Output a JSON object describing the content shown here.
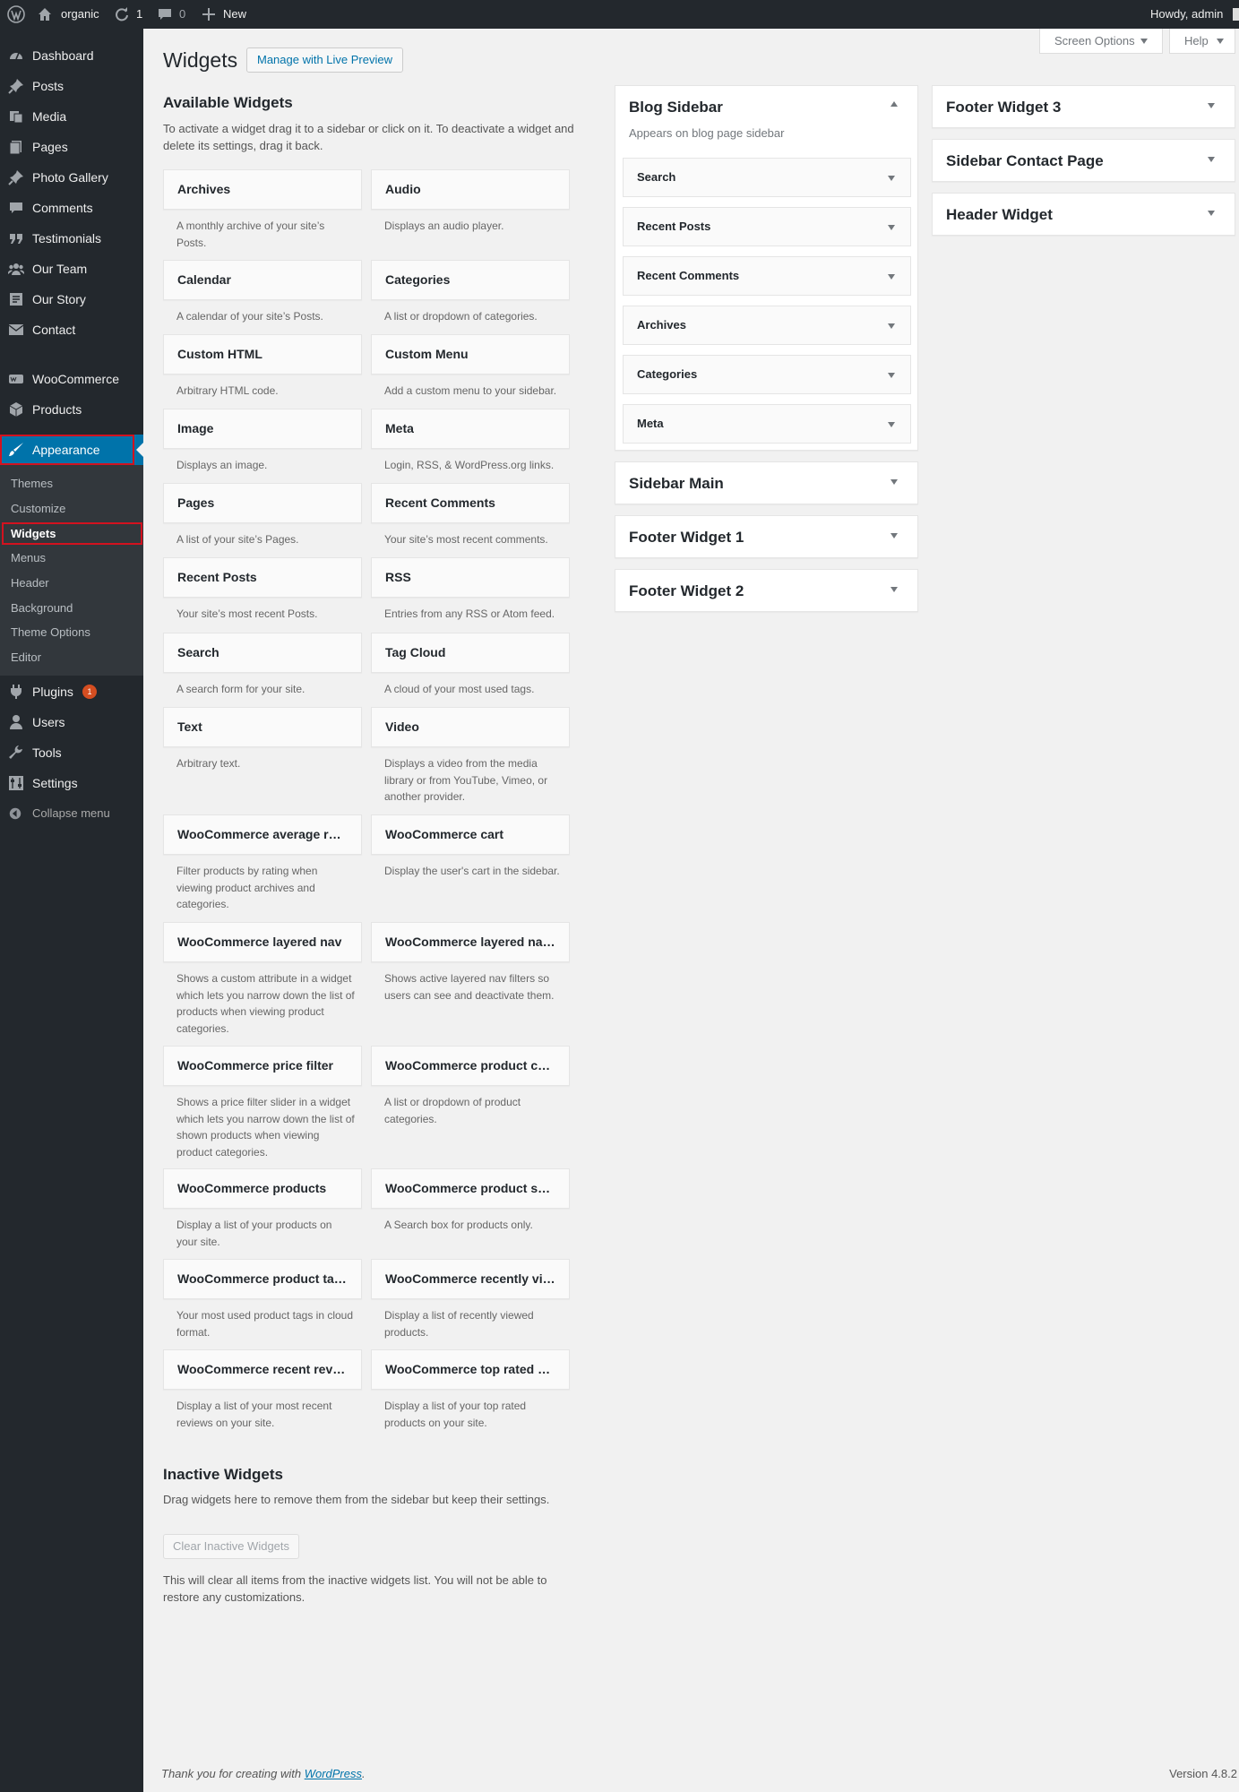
{
  "admin_bar": {
    "site_name": "organic",
    "updates_count": "1",
    "comments_count": "0",
    "new_label": "New",
    "howdy": "Howdy, admin"
  },
  "sidebar": {
    "items": [
      {
        "label": "Dashboard",
        "icon": "dashboard-icon"
      },
      {
        "label": "Posts",
        "icon": "pin-icon"
      },
      {
        "label": "Media",
        "icon": "media-icon"
      },
      {
        "label": "Pages",
        "icon": "pages-icon"
      },
      {
        "label": "Photo Gallery",
        "icon": "pin-icon"
      },
      {
        "label": "Comments",
        "icon": "comment-icon"
      },
      {
        "label": "Testimonials",
        "icon": "quote-icon"
      },
      {
        "label": "Our Team",
        "icon": "team-icon"
      },
      {
        "label": "Our Story",
        "icon": "book-icon"
      },
      {
        "label": "Contact",
        "icon": "email-icon"
      },
      {
        "label": "WooCommerce",
        "icon": "woo-icon"
      },
      {
        "label": "Products",
        "icon": "products-icon"
      },
      {
        "label": "Appearance",
        "icon": "brush-icon"
      },
      {
        "label": "Plugins",
        "icon": "plugin-icon",
        "badge": "1"
      },
      {
        "label": "Users",
        "icon": "user-icon"
      },
      {
        "label": "Tools",
        "icon": "wrench-icon"
      },
      {
        "label": "Settings",
        "icon": "settings-icon"
      }
    ],
    "submenu": [
      "Themes",
      "Customize",
      "Widgets",
      "Menus",
      "Header",
      "Background",
      "Theme Options",
      "Editor"
    ],
    "collapse_label": "Collapse menu"
  },
  "screen_options_label": "Screen Options",
  "help_label": "Help",
  "page_title": "Widgets",
  "live_preview_label": "Manage with Live Preview",
  "available": {
    "title": "Available Widgets",
    "description": "To activate a widget drag it to a sidebar or click on it. To deactivate a widget and delete its settings, drag it back.",
    "widgets": [
      {
        "name": "Archives",
        "desc": "A monthly archive of your site’s Posts."
      },
      {
        "name": "Audio",
        "desc": "Displays an audio player."
      },
      {
        "name": "Calendar",
        "desc": "A calendar of your site’s Posts."
      },
      {
        "name": "Categories",
        "desc": "A list or dropdown of categories."
      },
      {
        "name": "Custom HTML",
        "desc": "Arbitrary HTML code."
      },
      {
        "name": "Custom Menu",
        "desc": "Add a custom menu to your sidebar."
      },
      {
        "name": "Image",
        "desc": "Displays an image."
      },
      {
        "name": "Meta",
        "desc": "Login, RSS, & WordPress.org links."
      },
      {
        "name": "Pages",
        "desc": "A list of your site’s Pages."
      },
      {
        "name": "Recent Comments",
        "desc": "Your site’s most recent comments."
      },
      {
        "name": "Recent Posts",
        "desc": "Your site’s most recent Posts."
      },
      {
        "name": "RSS",
        "desc": "Entries from any RSS or Atom feed."
      },
      {
        "name": "Search",
        "desc": "A search form for your site."
      },
      {
        "name": "Tag Cloud",
        "desc": "A cloud of your most used tags."
      },
      {
        "name": "Text",
        "desc": "Arbitrary text."
      },
      {
        "name": "Video",
        "desc": "Displays a video from the media library or from YouTube, Vimeo, or another provider."
      },
      {
        "name": "WooCommerce average rating filter",
        "desc": "Filter products by rating when viewing product archives and categories."
      },
      {
        "name": "WooCommerce cart",
        "desc": "Display the user's cart in the sidebar."
      },
      {
        "name": "WooCommerce layered nav",
        "desc": "Shows a custom attribute in a widget which lets you narrow down the list of products when viewing product categories."
      },
      {
        "name": "WooCommerce layered nav filters",
        "desc": "Shows active layered nav filters so users can see and deactivate them."
      },
      {
        "name": "WooCommerce price filter",
        "desc": "Shows a price filter slider in a widget which lets you narrow down the list of shown products when viewing product categories."
      },
      {
        "name": "WooCommerce product categories",
        "desc": "A list or dropdown of product categories."
      },
      {
        "name": "WooCommerce products",
        "desc": "Display a list of your products on your site."
      },
      {
        "name": "WooCommerce product search",
        "desc": "A Search box for products only."
      },
      {
        "name": "WooCommerce product tags",
        "desc": "Your most used product tags in cloud format."
      },
      {
        "name": "WooCommerce recently viewed",
        "desc": "Display a list of recently viewed products."
      },
      {
        "name": "WooCommerce recent reviews",
        "desc": "Display a list of your most recent reviews on your site."
      },
      {
        "name": "WooCommerce top rated products",
        "desc": "Display a list of your top rated products on your site."
      }
    ]
  },
  "blog_sidebar": {
    "title": "Blog Sidebar",
    "description": "Appears on blog page sidebar",
    "widgets": [
      "Search",
      "Recent Posts",
      "Recent Comments",
      "Archives",
      "Categories",
      "Meta"
    ]
  },
  "collapsed_sidebars_col2": [
    "Sidebar Main",
    "Footer Widget 1",
    "Footer Widget 2"
  ],
  "collapsed_sidebars_col3": [
    "Footer Widget 3",
    "Sidebar Contact Page",
    "Header Widget"
  ],
  "inactive": {
    "title": "Inactive Widgets",
    "description": "Drag widgets here to remove them from the sidebar but keep their settings.",
    "clear_label": "Clear Inactive Widgets",
    "note": "This will clear all items from the inactive widgets list. You will not be able to restore any customizations."
  },
  "footer": {
    "thanks_prefix": "Thank you for creating with ",
    "thanks_link": "WordPress",
    "thanks_suffix": ".",
    "version": "Version 4.8.2"
  },
  "colors": {
    "admin_dark": "#23282d",
    "submenu_dark": "#32373c",
    "accent_blue": "#0073aa",
    "highlight_red": "#d3121f",
    "badge_orange": "#d54e21"
  }
}
